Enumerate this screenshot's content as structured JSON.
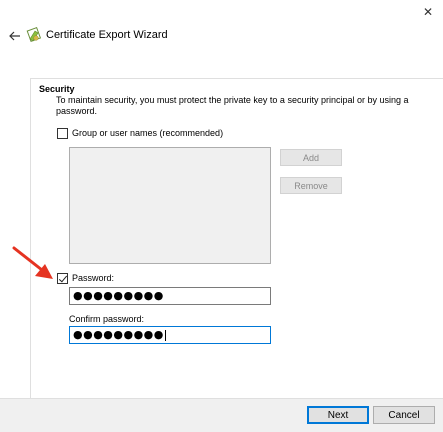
{
  "window": {
    "title": "Certificate Export Wizard",
    "close_glyph": "✕"
  },
  "security": {
    "heading": "Security",
    "description": "To maintain security, you must protect the private key to a security principal or by using a password.",
    "group_option": {
      "label": "Group or user names (recommended)",
      "checked": false
    },
    "add_label": "Add",
    "remove_label": "Remove",
    "password_option": {
      "label": "Password:",
      "checked": true
    },
    "password_value": "●●●●●●●●●",
    "confirm_label": "Confirm password:",
    "confirm_value": "●●●●●●●●●"
  },
  "footer": {
    "next_label": "Next",
    "cancel_label": "Cancel"
  },
  "icons": {
    "back": "back-arrow-icon",
    "wizard": "certificate-icon",
    "annotation": "red-pointer-arrow-icon"
  },
  "colors": {
    "focus_blue": "#0078d7",
    "annotation_red": "#e53321"
  }
}
